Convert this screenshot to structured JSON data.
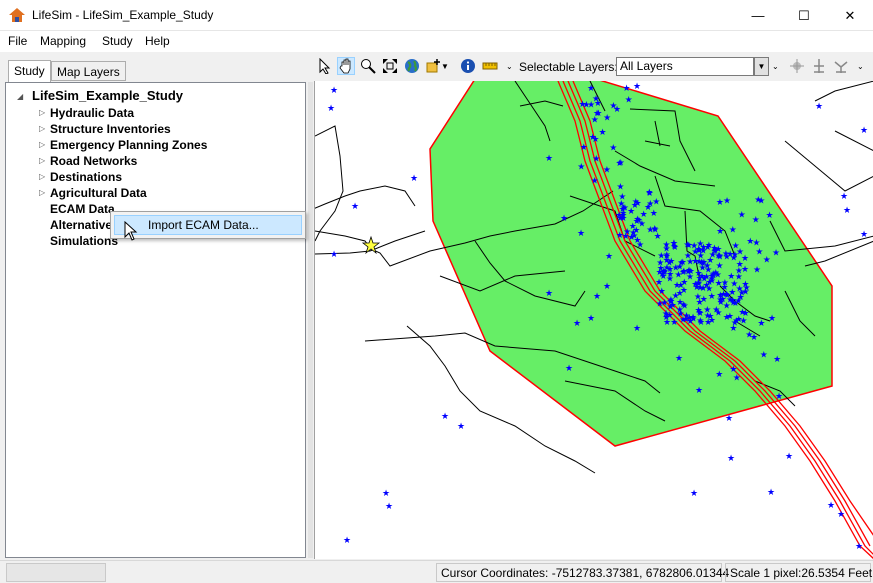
{
  "window": {
    "title": "LifeSim - LifeSim_Example_Study",
    "minimize_glyph": "—",
    "maximize_glyph": "☐",
    "close_glyph": "✕"
  },
  "menu": [
    "File",
    "Mapping",
    "Study",
    "Help"
  ],
  "tabs": [
    {
      "label": "Study",
      "active": true
    },
    {
      "label": "Map Layers",
      "active": false
    }
  ],
  "tree": {
    "root": "LifeSim_Example_Study",
    "items": [
      {
        "label": "Hydraulic Data",
        "expandable": true
      },
      {
        "label": "Structure Inventories",
        "expandable": true
      },
      {
        "label": "Emergency Planning Zones",
        "expandable": true
      },
      {
        "label": "Road Networks",
        "expandable": true
      },
      {
        "label": "Destinations",
        "expandable": true
      },
      {
        "label": "Agricultural Data",
        "expandable": true
      },
      {
        "label": "ECAM Data",
        "expandable": false
      },
      {
        "label": "Alternatives",
        "expandable": false
      },
      {
        "label": "Simulations",
        "expandable": false
      }
    ]
  },
  "context_menu": {
    "item": "Import ECAM Data..."
  },
  "toolbar": {
    "selectable_layers_label": "Selectable Layers:",
    "selectable_layers_value": "All Layers",
    "tools": [
      "select-arrow-icon",
      "pan-hand-icon",
      "zoom-icon",
      "zoom-extent-icon",
      "globe-icon",
      "add-layer-icon",
      "info-icon",
      "measure-ruler-icon"
    ]
  },
  "status": {
    "cursor": "Cursor Coordinates: -7512783.37381, 6782806.01344",
    "scale": "Scale 1 pixel:26.5354 Feet"
  },
  "map": {
    "polygon_fill": "#66ee66",
    "polygon_stroke": "#ff0000",
    "structure_color": "#0000ff",
    "highway_color": "#ff0000"
  }
}
